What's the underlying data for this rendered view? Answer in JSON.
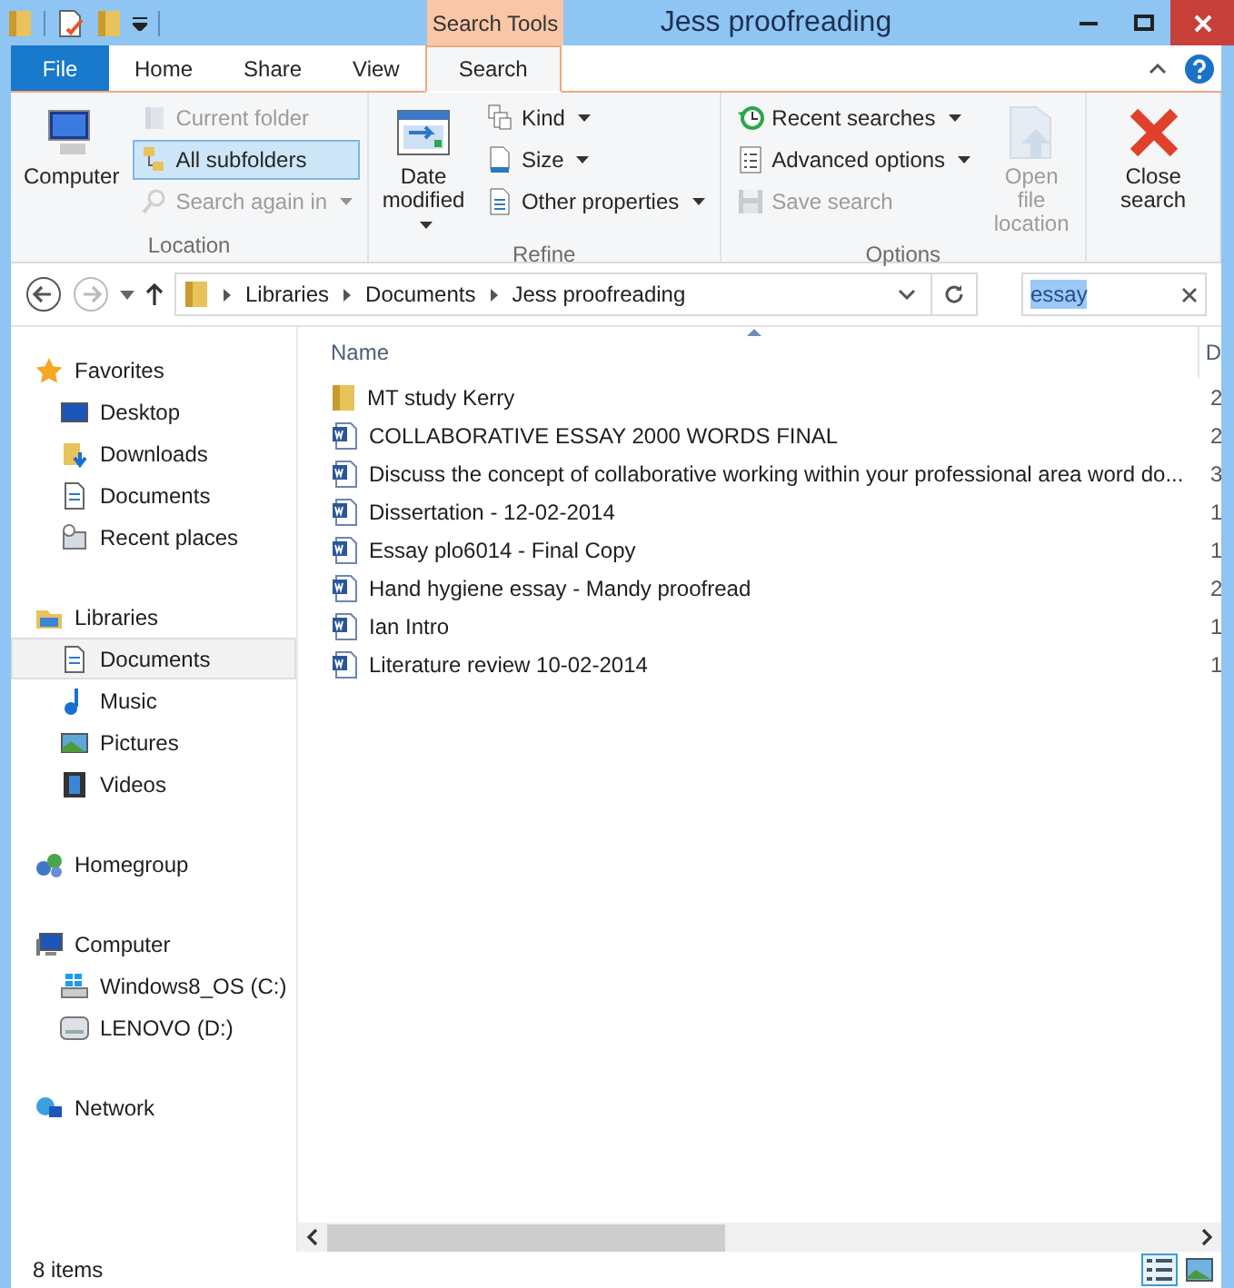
{
  "window": {
    "title": "Jess proofreading"
  },
  "context_tab": {
    "label": "Search Tools"
  },
  "tabs": [
    {
      "label": "File",
      "kind": "file",
      "selected": false
    },
    {
      "label": "Home",
      "kind": "tab",
      "selected": false
    },
    {
      "label": "Share",
      "kind": "tab",
      "selected": false
    },
    {
      "label": "View",
      "kind": "tab",
      "selected": false
    },
    {
      "label": "Search",
      "kind": "tab",
      "selected": true
    }
  ],
  "ribbon": {
    "groups": [
      {
        "label": "Location",
        "columns": [
          [
            {
              "label": "Computer",
              "kind": "large",
              "disabled": false,
              "on": false,
              "dropdown": false
            }
          ],
          [
            {
              "label": "Current folder",
              "kind": "small",
              "disabled": true,
              "on": false,
              "dropdown": false
            },
            {
              "label": "All subfolders",
              "kind": "small",
              "disabled": false,
              "on": true,
              "dropdown": false
            },
            {
              "label": "Search again in",
              "kind": "small",
              "disabled": true,
              "on": false,
              "dropdown": true
            }
          ]
        ]
      },
      {
        "label": "Refine",
        "columns": [
          [
            {
              "label": "Date modified",
              "kind": "large",
              "disabled": false,
              "on": false,
              "dropdown": true
            }
          ],
          [
            {
              "label": "Kind",
              "kind": "small",
              "disabled": false,
              "on": false,
              "dropdown": true
            },
            {
              "label": "Size",
              "kind": "small",
              "disabled": false,
              "on": false,
              "dropdown": true
            },
            {
              "label": "Other properties",
              "kind": "small",
              "disabled": false,
              "on": false,
              "dropdown": true
            }
          ]
        ]
      },
      {
        "label": "Options",
        "columns": [
          [
            {
              "label": "Recent searches",
              "kind": "small",
              "disabled": false,
              "on": false,
              "dropdown": true
            },
            {
              "label": "Advanced options",
              "kind": "small",
              "disabled": false,
              "on": false,
              "dropdown": true
            },
            {
              "label": "Save search",
              "kind": "small",
              "disabled": true,
              "on": false,
              "dropdown": false
            }
          ],
          [
            {
              "label": "Open file location",
              "kind": "large",
              "disabled": true,
              "on": false,
              "dropdown": false
            }
          ]
        ]
      },
      {
        "columns": [
          [
            {
              "label": "Close search",
              "kind": "large",
              "disabled": false,
              "on": false,
              "dropdown": false
            }
          ]
        ]
      }
    ]
  },
  "address": {
    "path": [
      "Libraries",
      "Documents",
      "Jess proofreading"
    ]
  },
  "search": {
    "value": "essay"
  },
  "navigation": [
    {
      "label": "Favorites",
      "selected": false,
      "children": [
        {
          "label": "Desktop",
          "selected": false
        },
        {
          "label": "Downloads",
          "selected": false
        },
        {
          "label": "Documents",
          "selected": false
        },
        {
          "label": "Recent places",
          "selected": false
        }
      ]
    },
    {
      "label": "Libraries",
      "selected": false,
      "children": [
        {
          "label": "Documents",
          "selected": true
        },
        {
          "label": "Music",
          "selected": false
        },
        {
          "label": "Pictures",
          "selected": false
        },
        {
          "label": "Videos",
          "selected": false
        }
      ]
    },
    {
      "label": "Homegroup",
      "selected": false
    },
    {
      "label": "Computer",
      "selected": false,
      "children": [
        {
          "label": "Windows8_OS (C:)",
          "selected": false
        },
        {
          "label": "LENOVO (D:)",
          "selected": false
        }
      ]
    },
    {
      "label": "Network",
      "selected": false
    }
  ],
  "file_list": {
    "columns": [
      "Name",
      "D"
    ],
    "rows": [
      {
        "name": "MT study Kerry",
        "kind": "folder",
        "column_2": "2"
      },
      {
        "name": "COLLABORATIVE ESSAY 2000 WORDS FINAL",
        "kind": "document",
        "column_2": "2"
      },
      {
        "name": "Discuss the concept of collaborative working within your professional area word do...",
        "kind": "document",
        "column_2": "3"
      },
      {
        "name": "Dissertation - 12-02-2014",
        "kind": "document",
        "column_2": "1"
      },
      {
        "name": "Essay plo6014 - Final Copy",
        "kind": "document",
        "column_2": "1"
      },
      {
        "name": "Hand hygiene essay - Mandy proofread",
        "kind": "document",
        "column_2": "2"
      },
      {
        "name": "Ian Intro",
        "kind": "document",
        "column_2": "1"
      },
      {
        "name": "Literature review 10-02-2014",
        "kind": "document",
        "column_2": "1"
      }
    ]
  },
  "status_bar": {
    "text": "8 items",
    "views": [
      {
        "kind": "details",
        "selected": true
      },
      {
        "kind": "thumbnails",
        "selected": false
      }
    ]
  }
}
